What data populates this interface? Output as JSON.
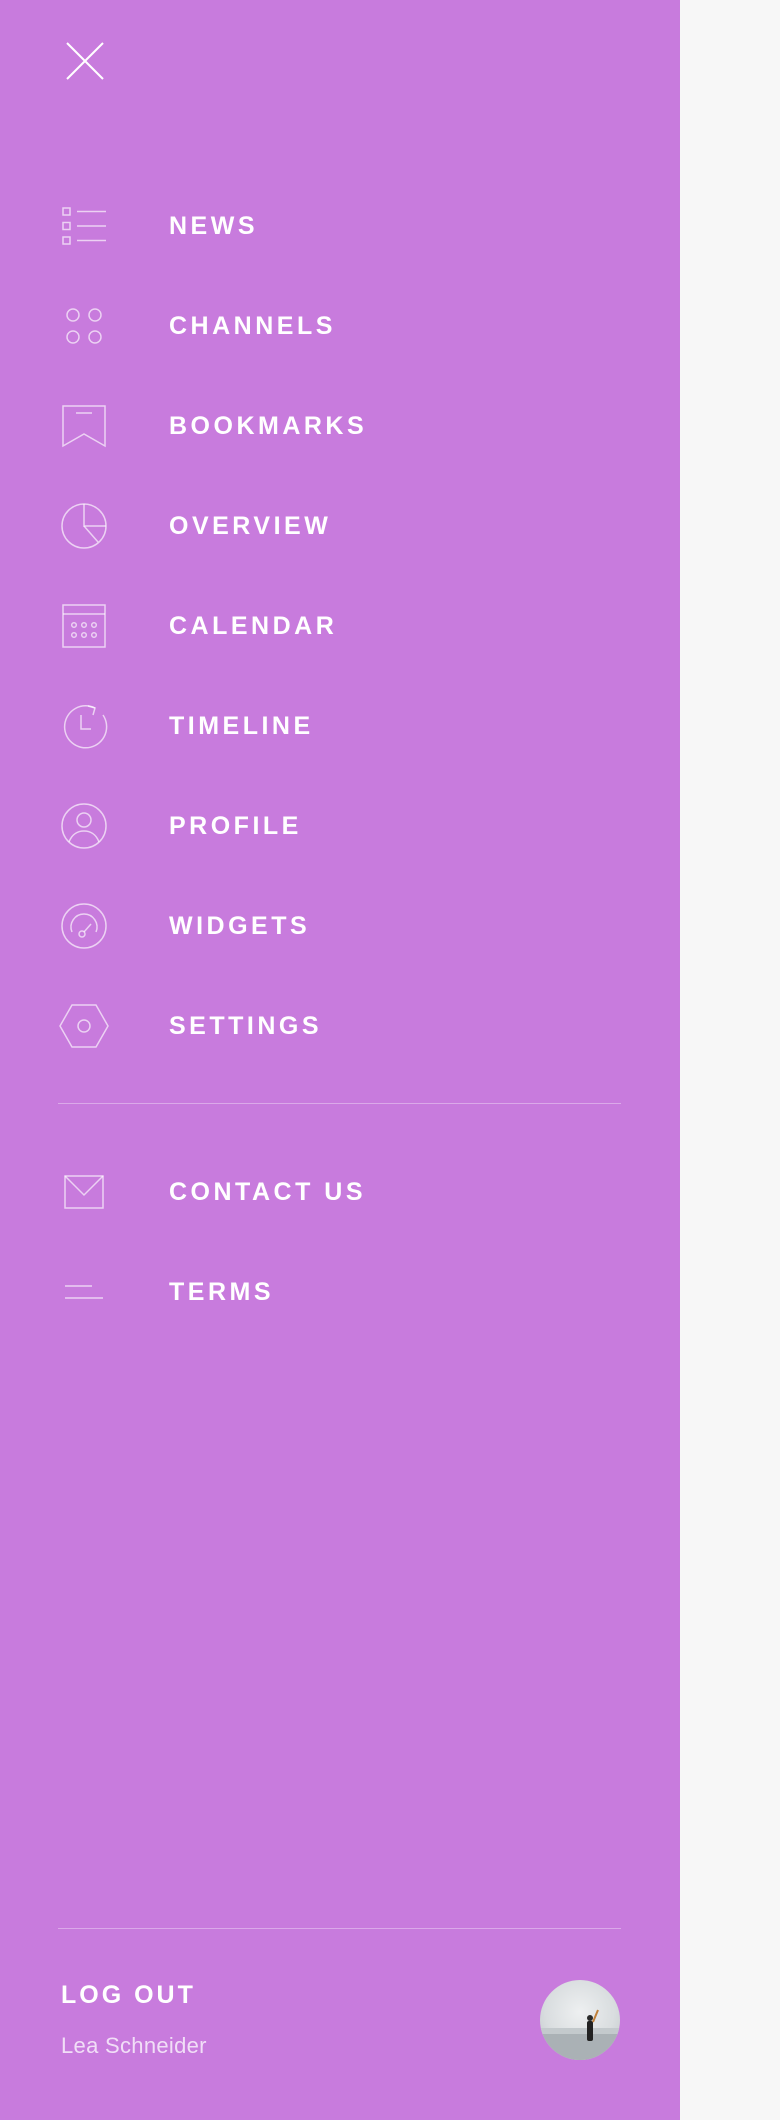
{
  "drawer": {
    "background": "#c87bdd",
    "close_icon": "close-icon",
    "main_items": [
      {
        "label": "NEWS",
        "icon": "list-icon"
      },
      {
        "label": "CHANNELS",
        "icon": "grid-dots-icon"
      },
      {
        "label": "BOOKMARKS",
        "icon": "bookmark-icon"
      },
      {
        "label": "OVERVIEW",
        "icon": "pie-chart-icon"
      },
      {
        "label": "CALENDAR",
        "icon": "calendar-icon"
      },
      {
        "label": "TIMELINE",
        "icon": "clock-refresh-icon"
      },
      {
        "label": "PROFILE",
        "icon": "user-circle-icon"
      },
      {
        "label": "WIDGETS",
        "icon": "gauge-icon"
      },
      {
        "label": "SETTINGS",
        "icon": "hexagon-gear-icon"
      }
    ],
    "secondary_items": [
      {
        "label": "CONTACT US",
        "icon": "mail-icon"
      },
      {
        "label": "TERMS",
        "icon": "text-lines-icon"
      }
    ],
    "footer": {
      "logout_label": "LOG OUT",
      "user_name": "Lea Schneider",
      "avatar_icon": "avatar-photo"
    }
  }
}
